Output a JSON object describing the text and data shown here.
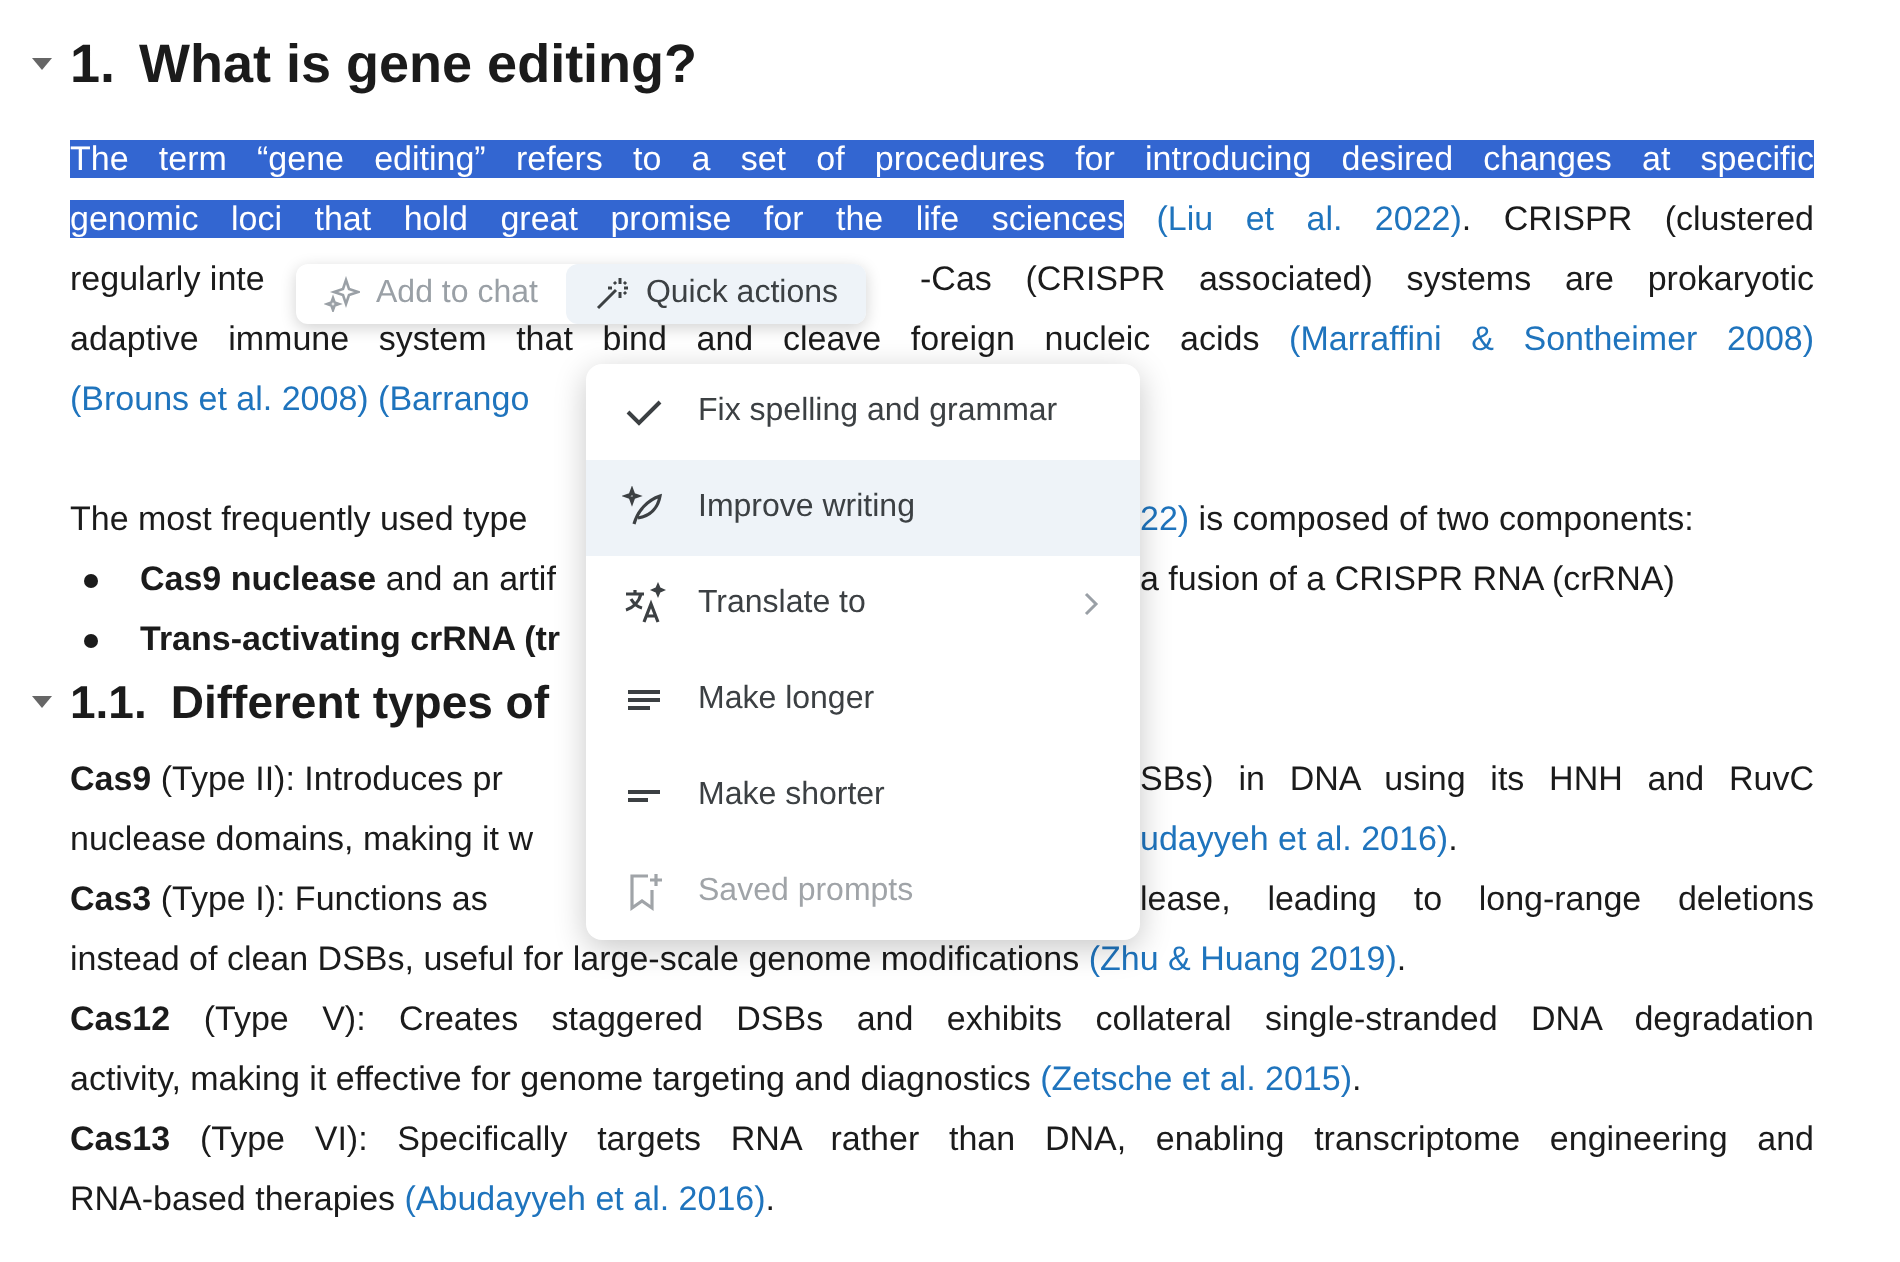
{
  "document": {
    "blocks": [
      {
        "kind": "heading1",
        "number": "1.",
        "title": "What is gene editing?",
        "expanded": true
      },
      {
        "kind": "line",
        "justified": true,
        "left": [
          {
            "kind": "selected",
            "text": "The term “gene editing” refers to a set of procedures for introducing desired changes at specific"
          }
        ]
      },
      {
        "kind": "line",
        "justified": true,
        "left": [
          {
            "kind": "selected",
            "text": "genomic loci that hold great promise for the life sciences"
          },
          {
            "kind": "link",
            "text": "(Liu et al. 2022)"
          },
          {
            "kind": "text",
            "text": ". CRISPR (clustered"
          }
        ]
      },
      {
        "kind": "line_toolbar",
        "justified": true,
        "left": [
          {
            "kind": "text",
            "text": "regularly inte"
          }
        ],
        "right": [
          {
            "kind": "text",
            "text": "-Cas (CRISPR associated) systems are prokaryotic"
          }
        ]
      },
      {
        "kind": "line",
        "justified": true,
        "left": [
          {
            "kind": "text",
            "text": "adaptive immune system that bind and cleave foreign nucleic acids "
          },
          {
            "kind": "link",
            "text": "(Marraffini & Sontheimer 2008)"
          }
        ]
      },
      {
        "kind": "line_menu",
        "left": [
          {
            "kind": "link",
            "text": "(Brouns et al. 2008)"
          },
          {
            "kind": "link",
            "text": "(Barrango"
          }
        ]
      },
      {
        "kind": "blank"
      },
      {
        "kind": "line_menu",
        "justified": false,
        "left": [
          {
            "kind": "text",
            "text": "The most frequently used type"
          }
        ],
        "right": [
          {
            "kind": "link",
            "text": "22)"
          },
          {
            "kind": "text",
            "text": " is composed of two components:"
          }
        ]
      },
      {
        "kind": "bullet_menu",
        "justified": false,
        "left": [
          {
            "kind": "text",
            "text": "**Cas9 nuclease** and an artif"
          }
        ],
        "right": [
          {
            "kind": "text",
            "text": " a fusion of a CRISPR RNA (crRNA)"
          }
        ]
      },
      {
        "kind": "bullet_menu",
        "left": [
          {
            "kind": "text",
            "text": "**Trans-activating crRNA (tr**"
          }
        ]
      },
      {
        "kind": "heading2",
        "number": "1.1.",
        "title": "Different types of",
        "expanded": true
      },
      {
        "kind": "line_menu",
        "justified": true,
        "left": [
          {
            "kind": "text",
            "text": "**Cas9** (Type II): Introduces pr"
          }
        ],
        "right": [
          {
            "kind": "text",
            "text": "SBs) in DNA using its HNH and RuvC"
          }
        ]
      },
      {
        "kind": "line_menu",
        "justified": false,
        "left": [
          {
            "kind": "text",
            "text": "nuclease domains, making it w"
          }
        ],
        "right": [
          {
            "kind": "link",
            "text": "udayyeh et al. 2016)"
          },
          {
            "kind": "text",
            "text": "."
          }
        ]
      },
      {
        "kind": "line_menu",
        "justified": true,
        "left": [
          {
            "kind": "text",
            "text": "**Cas3** (Type I): Functions as"
          }
        ],
        "right": [
          {
            "kind": "text",
            "text": "lease, leading to long-range deletions"
          }
        ]
      },
      {
        "kind": "line",
        "justified": false,
        "left": [
          {
            "kind": "text",
            "text": "instead of clean DSBs, useful for large-scale genome modifications "
          },
          {
            "kind": "link",
            "text": "(Zhu & Huang 2019)"
          },
          {
            "kind": "text",
            "text": "."
          }
        ]
      },
      {
        "kind": "line",
        "justified": true,
        "left": [
          {
            "kind": "text",
            "text": "**Cas12** (Type V): Creates staggered DSBs and exhibits collateral single-stranded DNA degradation"
          }
        ]
      },
      {
        "kind": "line",
        "justified": false,
        "left": [
          {
            "kind": "text",
            "text": "activity, making it effective for genome targeting and diagnostics "
          },
          {
            "kind": "link",
            "text": "(Zetsche et al. 2015)"
          },
          {
            "kind": "text",
            "text": "."
          }
        ]
      },
      {
        "kind": "line",
        "justified": true,
        "left": [
          {
            "kind": "text",
            "text": "**Cas13** (Type VI): Specifically targets RNA rather than DNA, enabling transcriptome engineering and"
          }
        ]
      },
      {
        "kind": "line",
        "justified": false,
        "left": [
          {
            "kind": "text",
            "text": "RNA-based therapies "
          },
          {
            "kind": "link",
            "text": "(Abudayyeh et al. 2016)"
          },
          {
            "kind": "text",
            "text": "."
          }
        ]
      }
    ]
  },
  "toolbar": {
    "buttons": [
      {
        "kind": "sparkle",
        "label": "Add to chat",
        "disabled": true,
        "active": false
      },
      {
        "kind": "wand",
        "label": "Quick actions",
        "disabled": false,
        "active": true
      }
    ]
  },
  "menu": {
    "items": [
      {
        "kind": "check",
        "label": "Fix spelling and grammar",
        "highlighted": false,
        "disabled": false,
        "submenu": false
      },
      {
        "kind": "quill",
        "label": "Improve writing",
        "highlighted": true,
        "disabled": false,
        "submenu": false
      },
      {
        "kind": "translate",
        "label": "Translate to",
        "highlighted": false,
        "disabled": false,
        "submenu": true
      },
      {
        "kind": "longer",
        "label": "Make longer",
        "highlighted": false,
        "disabled": false,
        "submenu": false
      },
      {
        "kind": "shorter",
        "label": "Make shorter",
        "highlighted": false,
        "disabled": false,
        "submenu": false
      },
      {
        "kind": "saved",
        "label": "Saved prompts",
        "highlighted": false,
        "disabled": true,
        "submenu": false
      }
    ]
  }
}
